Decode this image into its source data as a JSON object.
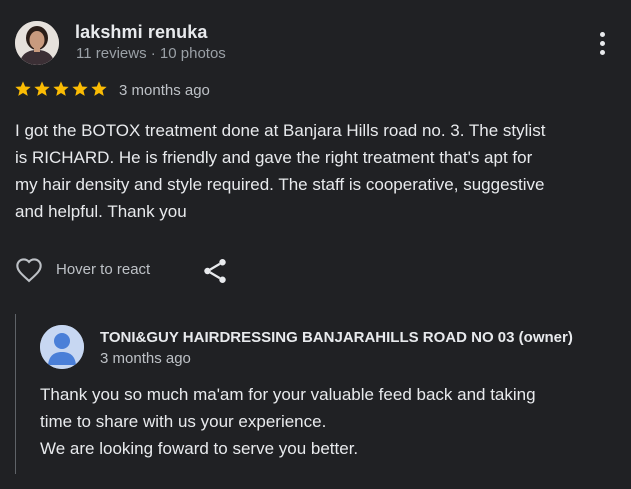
{
  "review": {
    "author": {
      "name": "lakshmi renuka",
      "meta": "11 reviews · 10 photos"
    },
    "rating": 5,
    "time": "3 months ago",
    "text_lines": [
      "I got the BOTOX treatment done at Banjara Hills road no. 3. The stylist",
      "is RICHARD. He is friendly and gave the right treatment that's apt for",
      "my hair density and style required. The staff is cooperative, suggestive",
      "and helpful. Thank you"
    ],
    "actions": {
      "react_label": "Hover to react",
      "react_icon": "heart-outline-icon",
      "share_icon": "share-icon",
      "more_icon": "more-vertical-icon"
    }
  },
  "owner_reply": {
    "name": "TONI&GUY HAIRDRESSING BANJARAHILLS ROAD NO 03 (owner)",
    "time": "3 months ago",
    "text_lines": [
      "Thank you so much ma'am for your valuable feed back and taking",
      "time to share with us your experience.",
      "We are looking foward to serve you better."
    ]
  },
  "colors": {
    "background": "#202124",
    "star": "#fbbc04",
    "primary_text": "#e8eaed",
    "secondary_text": "#9aa0a6"
  }
}
